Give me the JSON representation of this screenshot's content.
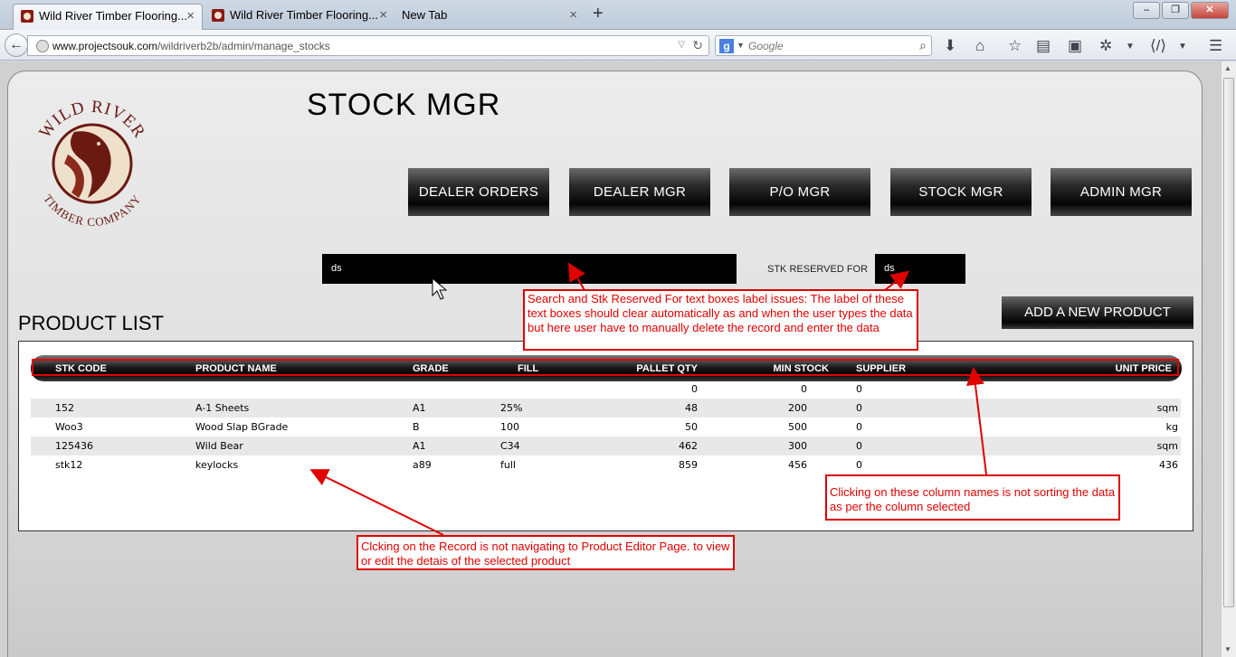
{
  "browser": {
    "tabs": [
      {
        "title": "Wild River Timber Flooring...",
        "active": true
      },
      {
        "title": "Wild River Timber Flooring...",
        "active": false
      },
      {
        "title": "New Tab",
        "active": false
      }
    ],
    "url_domain": "www.projectsouk.com",
    "url_path": "/wildriverb2b/admin/manage_stocks",
    "search_engine_placeholder": "Google",
    "window_buttons": [
      "–",
      "❐",
      "✕"
    ]
  },
  "header": {
    "logo_top_text": "WILD RIVER",
    "logo_bottom_text": "TIMBER COMPANY",
    "page_title": "STOCK MGR",
    "nav": [
      "DEALER ORDERS",
      "DEALER MGR",
      "P/O MGR",
      "STOCK MGR",
      "ADMIN MGR"
    ]
  },
  "filters": {
    "search_value": "ds",
    "stk_reserved_label": "STK RESERVED FOR",
    "stk_reserved_value": "ds"
  },
  "list": {
    "title": "PRODUCT LIST",
    "add_button": "ADD A NEW PRODUCT",
    "columns": [
      "STK CODE",
      "PRODUCT NAME",
      "GRADE",
      "FILL",
      "PALLET QTY",
      "MIN STOCK",
      "SUPPLIER",
      "UNIT PRICE"
    ],
    "rows": [
      {
        "code": "",
        "name": "",
        "grade": "",
        "fill": "",
        "pallet": "0",
        "min": "0",
        "supplier": "0",
        "price": ""
      },
      {
        "code": "152",
        "name": "A-1 Sheets",
        "grade": "A1",
        "fill": "25%",
        "pallet": "48",
        "min": "200",
        "supplier": "0",
        "price": "sqm"
      },
      {
        "code": "Woo3",
        "name": "Wood Slap BGrade",
        "grade": "B",
        "fill": "100",
        "pallet": "50",
        "min": "500",
        "supplier": "0",
        "price": "kg"
      },
      {
        "code": "125436",
        "name": "Wild Bear",
        "grade": "A1",
        "fill": "C34",
        "pallet": "462",
        "min": "300",
        "supplier": "0",
        "price": "sqm"
      },
      {
        "code": "stk12",
        "name": "keylocks",
        "grade": "a89",
        "fill": "full",
        "pallet": "859",
        "min": "456",
        "supplier": "0",
        "price": "436"
      }
    ]
  },
  "annotations": {
    "search_issue": "Search and Stk Reserved For text boxes label issues: The label of these text boxes should clear automatically as and when the user types the data but here user have to manually delete the record and  enter the data",
    "sort_issue": "Clicking on these column names is not sorting the data as per the column selected",
    "nav_issue": "Clcking on the Record is not navigating to Product Editor Page. to view or edit the detais of the selected product"
  },
  "colors": {
    "annotation_red": "#e00000",
    "logo_brown": "#6b1a12",
    "button_black": "#000000"
  }
}
